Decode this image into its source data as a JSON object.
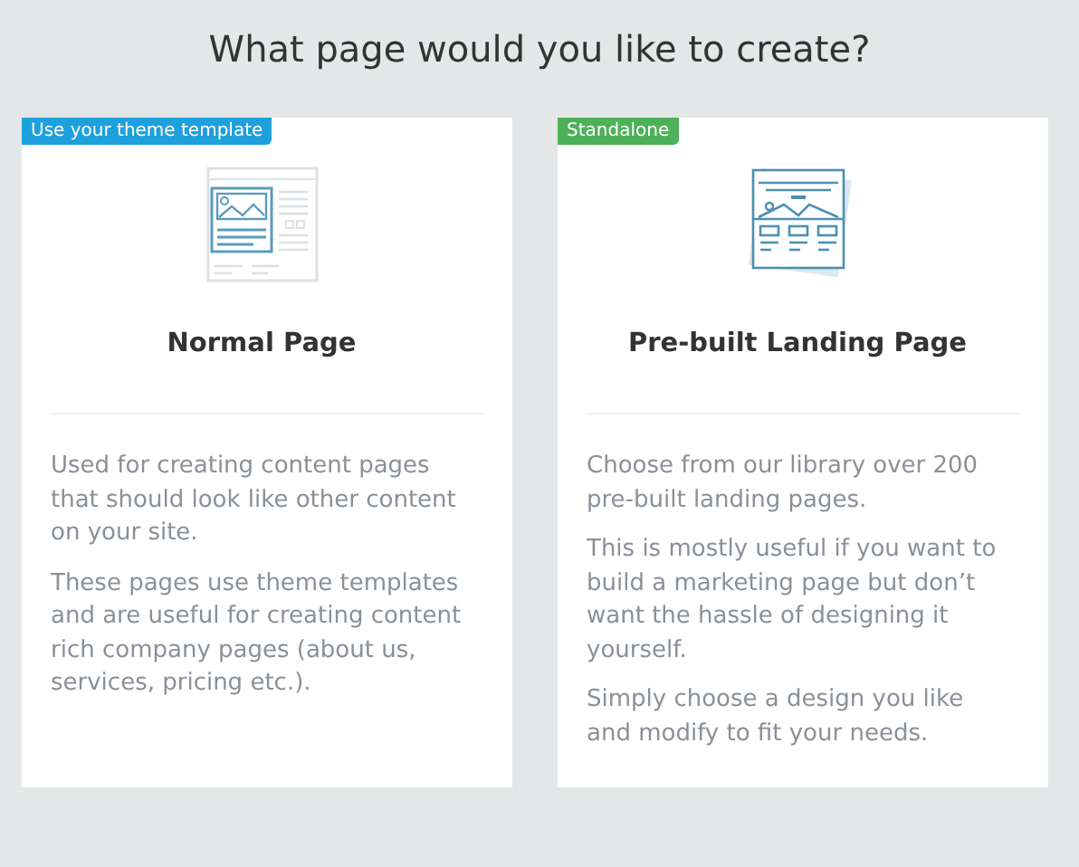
{
  "heading": "What page would you like to create?",
  "cards": [
    {
      "kind": "normal",
      "badge": "Use your theme template",
      "color": "#1ea0dd",
      "title": "Normal Page",
      "paragraphs": [
        "Used for creating content pages that should look like other content on your site.",
        "These pages use theme templates and are useful for creating content rich company pages (about us, services, pricing etc.)."
      ]
    },
    {
      "kind": "landing",
      "badge": "Standalone",
      "color": "#4cb158",
      "title": "Pre-built Landing Page",
      "paragraphs": [
        "Choose from our library over 200 pre-built landing pages.",
        "This is mostly useful if you want to build a marketing page but don’t want the hassle of designing it yourself.",
        "Simply choose a design you like and modify to fit your needs."
      ]
    }
  ]
}
